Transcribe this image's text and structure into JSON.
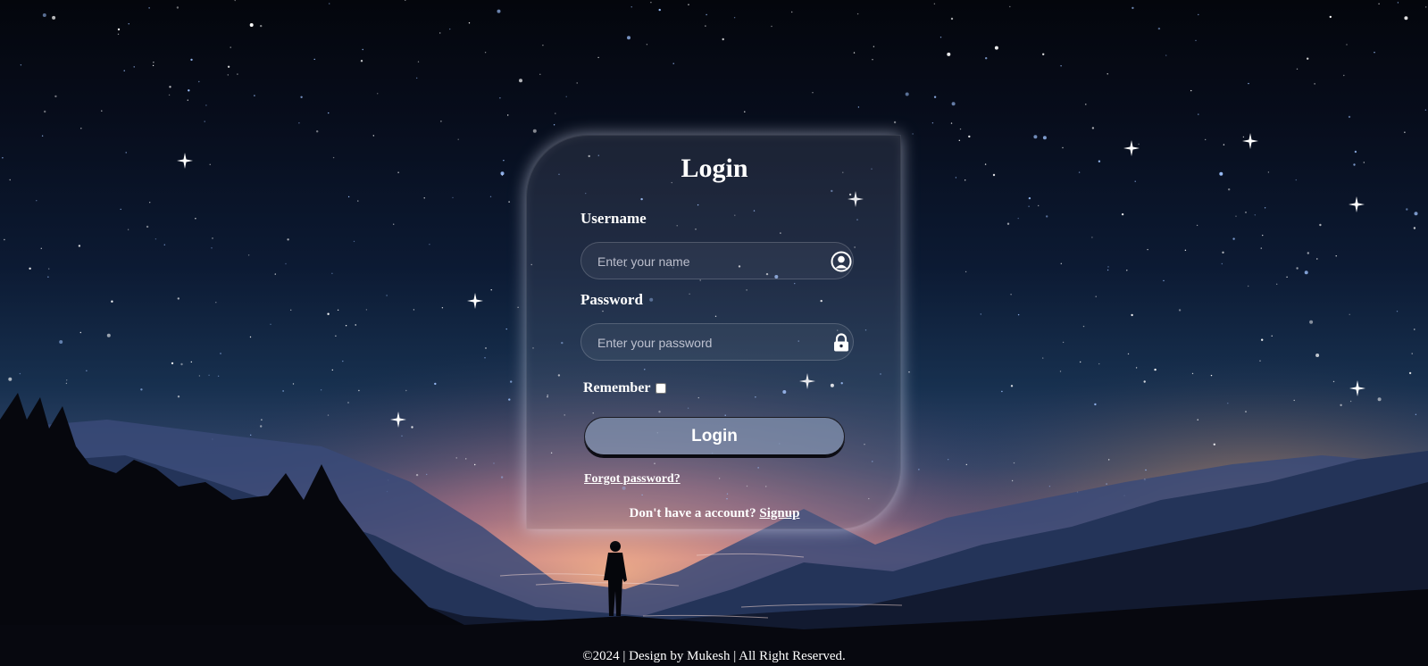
{
  "login_card": {
    "title": "Login",
    "username": {
      "label": "Username",
      "placeholder": "Enter your name",
      "icon": "user-circle-icon"
    },
    "password": {
      "label": "Password",
      "placeholder": "Enter your password",
      "icon": "lock-icon"
    },
    "remember_label": "Remember",
    "remember_checked": false,
    "login_button_label": "Login",
    "forgot_password_link": "Forgot password?",
    "signup_prompt": "Don't have a account?",
    "signup_link": "Signup"
  },
  "footer": {
    "text": "©2024 | Design by Mukesh | All Right Reserved."
  },
  "colors": {
    "text": "#ffffff",
    "sky_top": "#04060c",
    "horizon_glow": "#c88a8a"
  }
}
